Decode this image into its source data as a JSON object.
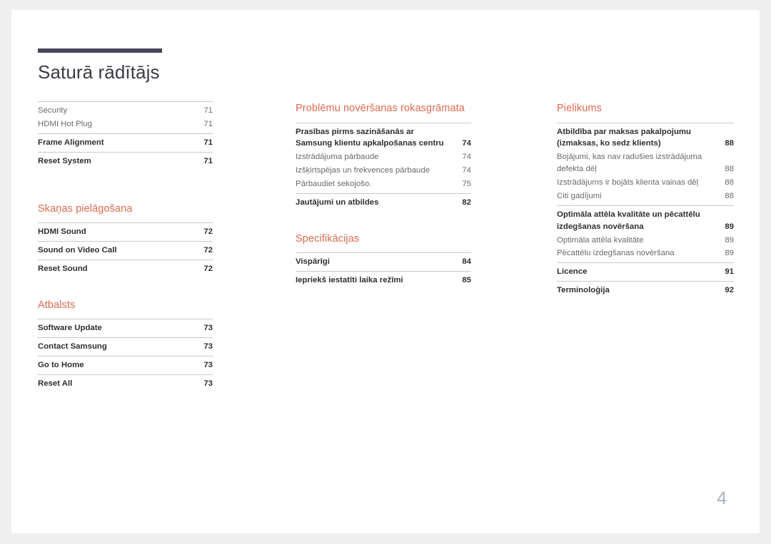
{
  "document": {
    "title": "Saturā rādītājs",
    "page_number": "4",
    "accent_color": "#dd6b4f",
    "rule_color": "#474658",
    "folio_color": "#aeb2c2"
  },
  "columns": [
    {
      "id": "column-left",
      "sections": [
        {
          "heading": "",
          "heading_visible": false,
          "groups": [
            {
              "entries": [
                {
                  "label": "Security",
                  "page": "71",
                  "level": 2
                },
                {
                  "label": "HDMI Hot Plug",
                  "page": "71",
                  "level": 2
                }
              ]
            },
            {
              "entries": [
                {
                  "label": "Frame Alignment",
                  "page": "71",
                  "level": 1
                }
              ]
            },
            {
              "entries": [
                {
                  "label": "Reset System",
                  "page": "71",
                  "level": 1
                }
              ]
            }
          ]
        },
        {
          "heading": "Skaņas pielāgošana",
          "heading_visible": true,
          "groups": [
            {
              "entries": [
                {
                  "label": "HDMI Sound",
                  "page": "72",
                  "level": 1
                }
              ]
            },
            {
              "entries": [
                {
                  "label": "Sound on Video Call",
                  "page": "72",
                  "level": 1
                }
              ]
            },
            {
              "entries": [
                {
                  "label": "Reset Sound",
                  "page": "72",
                  "level": 1
                }
              ]
            }
          ]
        },
        {
          "heading": "Atbalsts",
          "heading_visible": true,
          "groups": [
            {
              "entries": [
                {
                  "label": "Software Update",
                  "page": "73",
                  "level": 1
                }
              ]
            },
            {
              "entries": [
                {
                  "label": "Contact Samsung",
                  "page": "73",
                  "level": 1
                }
              ]
            },
            {
              "entries": [
                {
                  "label": "Go to Home",
                  "page": "73",
                  "level": 1
                }
              ]
            },
            {
              "entries": [
                {
                  "label": "Reset All",
                  "page": "73",
                  "level": 1
                }
              ]
            }
          ]
        }
      ]
    },
    {
      "id": "column-middle",
      "sections": [
        {
          "heading": "Problēmu novēršanas rokasgrāmata",
          "heading_visible": true,
          "groups": [
            {
              "entries": [
                {
                  "label": "Prasības pirms sazināšanās ar Samsung klientu apkalpošanas centru",
                  "page": "74",
                  "level": 1
                },
                {
                  "label": "Izstrādājuma pārbaude",
                  "page": "74",
                  "level": 2
                },
                {
                  "label": "Izšķirtspējas un frekvences pārbaude",
                  "page": "74",
                  "level": 2
                },
                {
                  "label": "Pārbaudiet sekojošo.",
                  "page": "75",
                  "level": 2
                }
              ]
            },
            {
              "entries": [
                {
                  "label": "Jautājumi un atbildes",
                  "page": "82",
                  "level": 1
                }
              ]
            }
          ]
        },
        {
          "heading": "Specifikācijas",
          "heading_visible": true,
          "groups": [
            {
              "entries": [
                {
                  "label": "Vispārīgi",
                  "page": "84",
                  "level": 1
                }
              ]
            },
            {
              "entries": [
                {
                  "label": "Iepriekš iestatīti laika režīmi",
                  "page": "85",
                  "level": 1
                }
              ]
            }
          ]
        }
      ]
    },
    {
      "id": "column-right",
      "sections": [
        {
          "heading": "Pielikums",
          "heading_visible": true,
          "groups": [
            {
              "entries": [
                {
                  "label": "Atbildība par maksas pakalpojumu (izmaksas, ko sedz klients)",
                  "page": "88",
                  "level": 1
                },
                {
                  "label": "Bojājumi, kas nav radušies izstrādājuma defekta dēļ",
                  "page": "88",
                  "level": 2
                },
                {
                  "label": "Izstrādājums ir bojāts klienta vainas dēļ",
                  "page": "88",
                  "level": 2
                },
                {
                  "label": "Citi gadījumi",
                  "page": "88",
                  "level": 2
                }
              ]
            },
            {
              "entries": [
                {
                  "label": "Optimāla attēla kvalitāte un pēcattēlu izdegšanas novēršana",
                  "page": "89",
                  "level": 1
                },
                {
                  "label": "Optimāla attēla kvalitāte",
                  "page": "89",
                  "level": 2
                },
                {
                  "label": "Pēcattēlu izdegšanas novēršana",
                  "page": "89",
                  "level": 2
                }
              ]
            },
            {
              "entries": [
                {
                  "label": "Licence",
                  "page": "91",
                  "level": 1
                }
              ]
            },
            {
              "entries": [
                {
                  "label": "Terminoloģija",
                  "page": "92",
                  "level": 1
                }
              ]
            }
          ]
        }
      ]
    }
  ]
}
